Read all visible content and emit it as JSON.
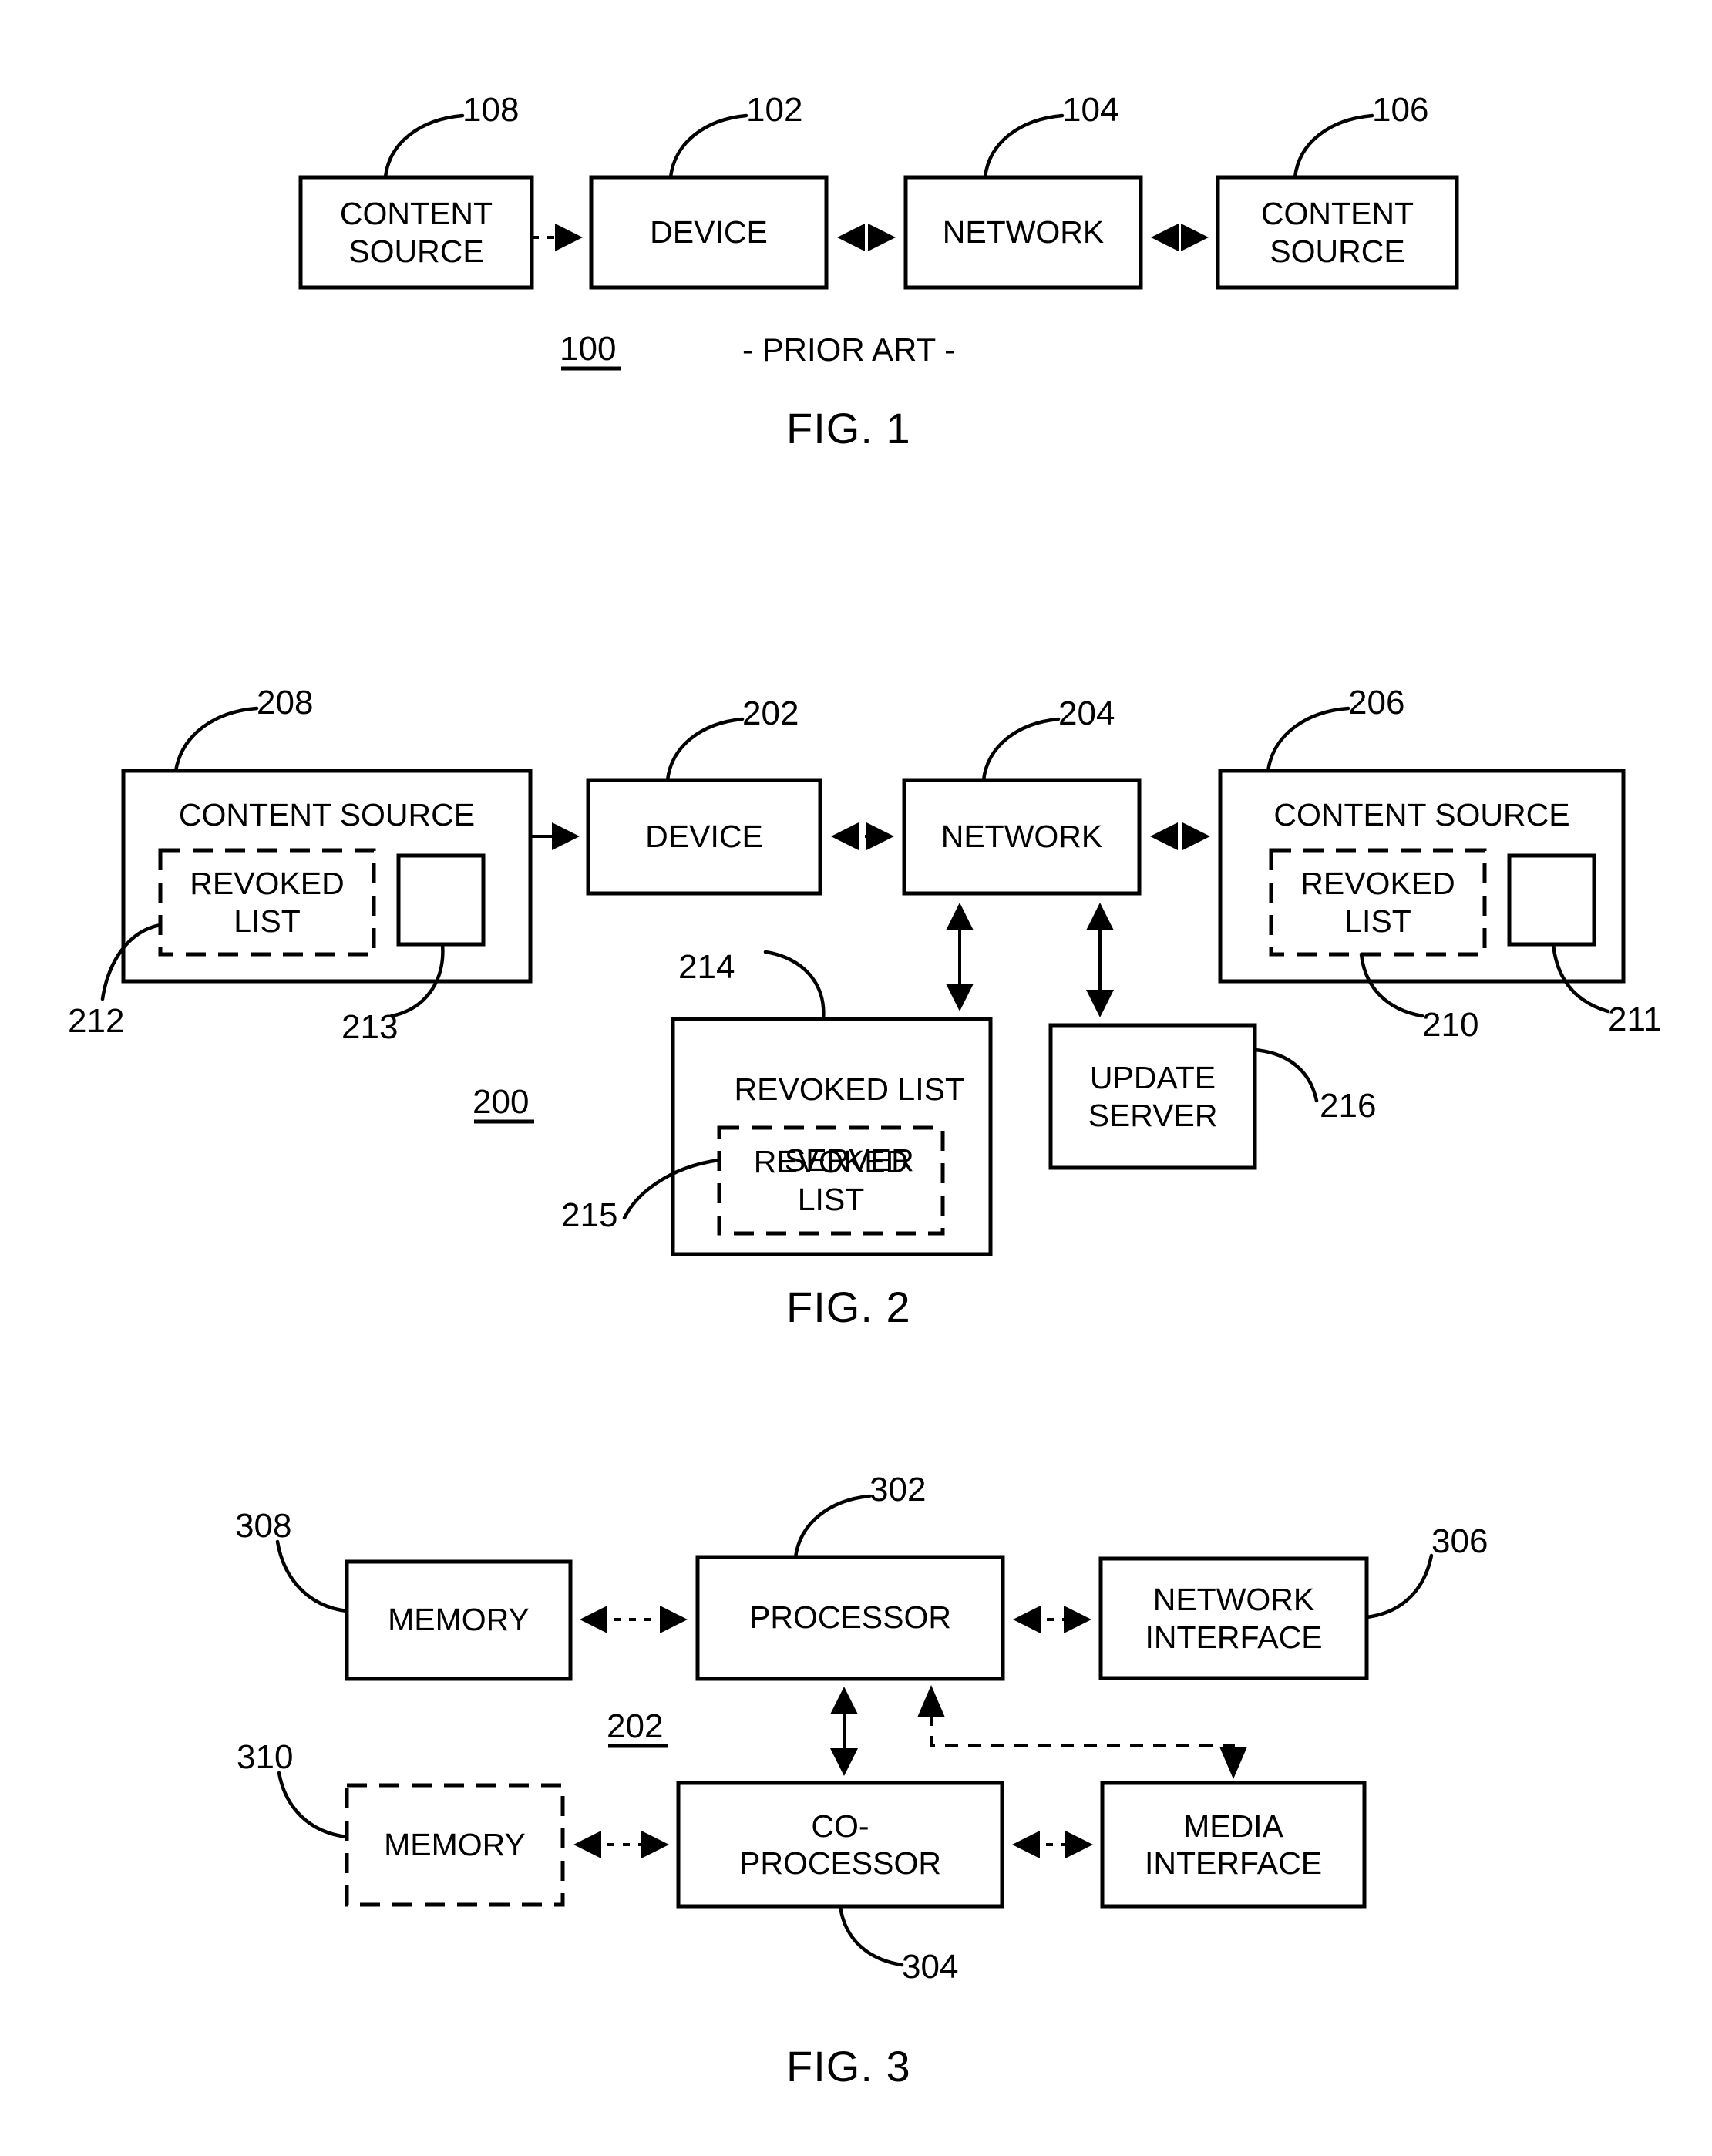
{
  "document": {
    "type": "patent-drawing-sheet",
    "figures": [
      "FIG. 1",
      "FIG. 2",
      "FIG. 3"
    ]
  },
  "figure1": {
    "caption": "FIG. 1",
    "system_number": "100",
    "note": "- PRIOR ART -",
    "blocks": [
      {
        "id": "content-source-108",
        "label": "CONTENT\nSOURCE",
        "ref": "108"
      },
      {
        "id": "device-102",
        "label": "DEVICE",
        "ref": "102"
      },
      {
        "id": "network-104",
        "label": "NETWORK",
        "ref": "104"
      },
      {
        "id": "content-source-106",
        "label": "CONTENT\nSOURCE",
        "ref": "106"
      }
    ],
    "connections": [
      {
        "from": "content-source-108",
        "to": "device-102",
        "style": "dotted",
        "arrows": "single"
      },
      {
        "from": "device-102",
        "to": "network-104",
        "style": "dotted",
        "arrows": "double"
      },
      {
        "from": "network-104",
        "to": "content-source-106",
        "style": "dotted",
        "arrows": "double"
      }
    ]
  },
  "figure2": {
    "caption": "FIG. 2",
    "system_number": "200",
    "blocks": [
      {
        "id": "content-source-208",
        "label": "CONTENT SOURCE",
        "ref": "208",
        "inner_dashed": {
          "label": "REVOKED\nLIST",
          "ref": "212"
        },
        "inner_solid": {
          "label": "",
          "ref": "213"
        }
      },
      {
        "id": "device-202",
        "label": "DEVICE",
        "ref": "202"
      },
      {
        "id": "network-204",
        "label": "NETWORK",
        "ref": "204"
      },
      {
        "id": "content-source-206",
        "label": "CONTENT SOURCE",
        "ref": "206",
        "inner_dashed": {
          "label": "REVOKED\nLIST",
          "ref": "210"
        },
        "inner_solid": {
          "label": "",
          "ref": "211"
        }
      },
      {
        "id": "revoked-list-server-214",
        "label": "REVOKED LIST\nSERVER",
        "ref": "214",
        "inner_dashed": {
          "label": "REVOKED\nLIST",
          "ref": "215"
        }
      },
      {
        "id": "update-server-216",
        "label": "UPDATE\nSERVER",
        "ref": "216"
      }
    ],
    "connections": [
      {
        "from": "content-source-208",
        "to": "device-202",
        "style": "solid",
        "arrows": "single"
      },
      {
        "from": "device-202",
        "to": "network-204",
        "style": "dotted",
        "arrows": "double"
      },
      {
        "from": "network-204",
        "to": "content-source-206",
        "style": "dotted",
        "arrows": "double"
      },
      {
        "from": "network-204",
        "to": "revoked-list-server-214",
        "style": "solid",
        "arrows": "double"
      },
      {
        "from": "network-204",
        "to": "update-server-216",
        "style": "solid",
        "arrows": "double"
      }
    ]
  },
  "figure3": {
    "caption": "FIG. 3",
    "system_number": "202",
    "blocks": [
      {
        "id": "memory-308",
        "label": "MEMORY",
        "ref": "308",
        "border": "solid"
      },
      {
        "id": "processor-302",
        "label": "PROCESSOR",
        "ref": "302",
        "border": "solid"
      },
      {
        "id": "network-interface-306",
        "label": "NETWORK\nINTERFACE",
        "ref": "306",
        "border": "solid"
      },
      {
        "id": "memory-310",
        "label": "MEMORY",
        "ref": "310",
        "border": "dashed"
      },
      {
        "id": "co-processor-304",
        "label": "CO-\nPROCESSOR",
        "ref": "304",
        "border": "solid"
      },
      {
        "id": "media-interface",
        "label": "MEDIA\nINTERFACE",
        "ref": "",
        "border": "solid"
      }
    ],
    "connections": [
      {
        "from": "memory-308",
        "to": "processor-302",
        "style": "dotted",
        "arrows": "double"
      },
      {
        "from": "processor-302",
        "to": "network-interface-306",
        "style": "dotted",
        "arrows": "double"
      },
      {
        "from": "processor-302",
        "to": "co-processor-304",
        "style": "solid",
        "arrows": "double"
      },
      {
        "from": "network-interface-306",
        "to": "media-interface",
        "style": "dashed",
        "arrows": "double"
      },
      {
        "from": "memory-310",
        "to": "co-processor-304",
        "style": "dotted",
        "arrows": "double"
      },
      {
        "from": "co-processor-304",
        "to": "media-interface",
        "style": "dotted",
        "arrows": "double"
      }
    ]
  },
  "text": {
    "f1_b1": "CONTENT",
    "f1_b1b": "SOURCE",
    "f1_b2": "DEVICE",
    "f1_b3": "NETWORK",
    "f1_b4": "CONTENT",
    "f1_b4b": "SOURCE",
    "f1_ref108": "108",
    "f1_ref102": "102",
    "f1_ref104": "104",
    "f1_ref106": "106",
    "f1_sys": "100",
    "f1_prior": "- PRIOR ART -",
    "f1_cap": "FIG. 1",
    "f2_b1": "CONTENT SOURCE",
    "f2_b1_inner_a": "REVOKED",
    "f2_b1_inner_b": "LIST",
    "f2_b2": "DEVICE",
    "f2_b3": "NETWORK",
    "f2_b4": "CONTENT SOURCE",
    "f2_b4_inner_a": "REVOKED",
    "f2_b4_inner_b": "LIST",
    "f2_b5_a": "REVOKED LIST",
    "f2_b5_b": "SERVER",
    "f2_b5_inner_a": "REVOKED",
    "f2_b5_inner_b": "LIST",
    "f2_b6_a": "UPDATE",
    "f2_b6_b": "SERVER",
    "f2_ref208": "208",
    "f2_ref202": "202",
    "f2_ref204": "204",
    "f2_ref206": "206",
    "f2_ref212": "212",
    "f2_ref213": "213",
    "f2_ref210": "210",
    "f2_ref211": "211",
    "f2_ref214": "214",
    "f2_ref215": "215",
    "f2_ref216": "216",
    "f2_sys": "200",
    "f2_cap": "FIG. 2",
    "f3_b1": "MEMORY",
    "f3_b2": "PROCESSOR",
    "f3_b3_a": "NETWORK",
    "f3_b3_b": "INTERFACE",
    "f3_b4": "MEMORY",
    "f3_b5_a": "CO-",
    "f3_b5_b": "PROCESSOR",
    "f3_b6_a": "MEDIA",
    "f3_b6_b": "INTERFACE",
    "f3_ref308": "308",
    "f3_ref302": "302",
    "f3_ref306": "306",
    "f3_ref310": "310",
    "f3_ref304": "304",
    "f3_sys": "202",
    "f3_cap": "FIG. 3"
  },
  "colors": {
    "ink": "#000000",
    "paper": "#ffffff"
  }
}
